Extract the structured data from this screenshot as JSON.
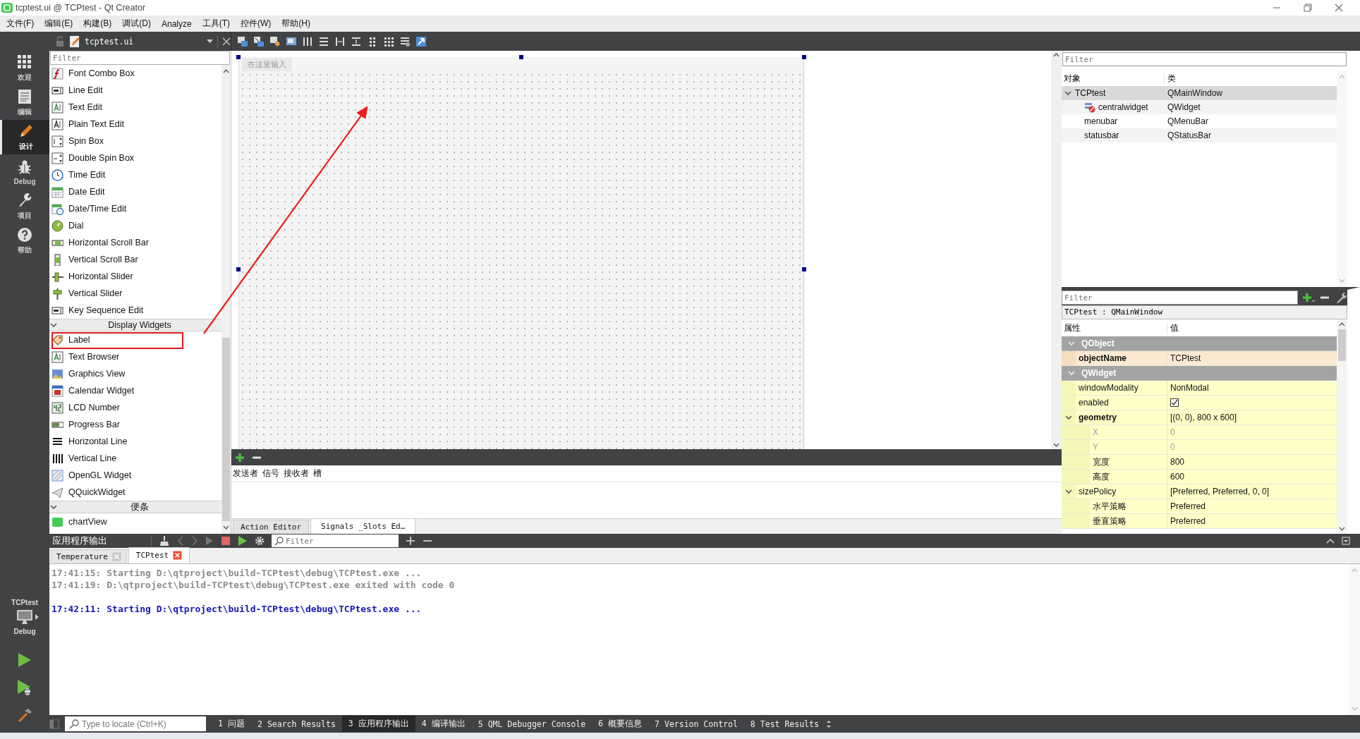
{
  "window": {
    "title": "tcptest.ui @ TCPtest - Qt Creator"
  },
  "menu": [
    "文件(F)",
    "编辑(E)",
    "构建(B)",
    "调试(D)",
    "Analyze",
    "工具(T)",
    "控件(W)",
    "帮助(H)"
  ],
  "mode_bar": {
    "modes": [
      {
        "label": "欢迎",
        "selected": false
      },
      {
        "label": "编辑",
        "selected": false
      },
      {
        "label": "设计",
        "selected": true
      },
      {
        "label": "Debug",
        "selected": false
      },
      {
        "label": "项目",
        "selected": false
      },
      {
        "label": "帮助",
        "selected": false
      }
    ],
    "kit": {
      "project": "TCPtest",
      "build": "Debug"
    }
  },
  "editor_toolbar": {
    "file": "tcptest.ui"
  },
  "widget_box": {
    "filter": {
      "placeholder": "Filter"
    },
    "items": [
      {
        "kind": "widget",
        "label": "Font Combo Box",
        "highlighted": false
      },
      {
        "kind": "widget",
        "label": "Line Edit",
        "highlighted": false
      },
      {
        "kind": "widget",
        "label": "Text Edit",
        "highlighted": false
      },
      {
        "kind": "widget",
        "label": "Plain Text Edit",
        "highlighted": false
      },
      {
        "kind": "widget",
        "label": "Spin Box",
        "highlighted": false
      },
      {
        "kind": "widget",
        "label": "Double Spin Box",
        "highlighted": false
      },
      {
        "kind": "widget",
        "label": "Time Edit",
        "highlighted": false
      },
      {
        "kind": "widget",
        "label": "Date Edit",
        "highlighted": false
      },
      {
        "kind": "widget",
        "label": "Date/Time Edit",
        "highlighted": false
      },
      {
        "kind": "widget",
        "label": "Dial",
        "highlighted": false
      },
      {
        "kind": "widget",
        "label": "Horizontal Scroll Bar",
        "highlighted": false
      },
      {
        "kind": "widget",
        "label": "Vertical Scroll Bar",
        "highlighted": false
      },
      {
        "kind": "widget",
        "label": "Horizontal Slider",
        "highlighted": false
      },
      {
        "kind": "widget",
        "label": "Vertical Slider",
        "highlighted": false
      },
      {
        "kind": "widget",
        "label": "Key Sequence Edit",
        "highlighted": false
      },
      {
        "kind": "category",
        "label": "Display Widgets",
        "expanded": true,
        "highlighted": false
      },
      {
        "kind": "widget",
        "label": "Label",
        "highlighted": true
      },
      {
        "kind": "widget",
        "label": "Text Browser",
        "highlighted": false
      },
      {
        "kind": "widget",
        "label": "Graphics View",
        "highlighted": false
      },
      {
        "kind": "widget",
        "label": "Calendar Widget",
        "highlighted": false
      },
      {
        "kind": "widget",
        "label": "LCD Number",
        "highlighted": false
      },
      {
        "kind": "widget",
        "label": "Progress Bar",
        "highlighted": false
      },
      {
        "kind": "widget",
        "label": "Horizontal Line",
        "highlighted": false
      },
      {
        "kind": "widget",
        "label": "Vertical Line",
        "highlighted": false
      },
      {
        "kind": "widget",
        "label": "OpenGL Widget",
        "highlighted": false
      },
      {
        "kind": "widget",
        "label": "QQuickWidget",
        "highlighted": false
      },
      {
        "kind": "category",
        "label": "便条",
        "expanded": true,
        "highlighted": false
      },
      {
        "kind": "widget",
        "label": "chartView",
        "highlighted": false
      }
    ]
  },
  "form_editor": {
    "form": {
      "selected": true,
      "menu_placeholder": "在这里输入"
    },
    "annotation_arrow": true
  },
  "signal_slot_editor": {
    "columns": [
      "发送者",
      "信号",
      "接收者",
      "槽"
    ],
    "tabs": [
      {
        "label": "Action Editor",
        "selected": false
      },
      {
        "label": "Signals _Slots Ed…",
        "selected": true
      }
    ]
  },
  "object_inspector": {
    "filter": {
      "placeholder": "Filter"
    },
    "columns": [
      "对象",
      "类"
    ],
    "tree": [
      {
        "name": "TCPtest",
        "class": "QMainWindow",
        "selected": true,
        "expanded": true,
        "children": [
          {
            "name": "centralwidget",
            "class": "QWidget",
            "kind": "container",
            "selected": false
          },
          {
            "name": "menubar",
            "class": "QMenuBar",
            "kind": "plain",
            "selected": false
          },
          {
            "name": "statusbar",
            "class": "QStatusBar",
            "kind": "plain",
            "selected": false
          }
        ]
      }
    ]
  },
  "property_editor": {
    "filter": {
      "placeholder": "Filter"
    },
    "context": "TCPtest : QMainWindow",
    "columns": [
      "属性",
      "值"
    ],
    "groups": [
      {
        "name": "QObject",
        "expanded": true,
        "properties": [
          {
            "name": "objectName",
            "kind": "text",
            "value": "TCPtest",
            "modified": true
          }
        ]
      },
      {
        "name": "QWidget",
        "expanded": true,
        "properties": [
          {
            "name": "windowModality",
            "kind": "text",
            "value": "NonModal",
            "modified": false
          },
          {
            "name": "enabled",
            "kind": "checkbox",
            "checked": true,
            "modified": false
          },
          {
            "name": "geometry",
            "kind": "text",
            "value": "[(0, 0), 800 x 600]",
            "modified": true,
            "expanded": true,
            "children": [
              {
                "name": "X",
                "value": "0",
                "disabled": true
              },
              {
                "name": "Y",
                "value": "0",
                "disabled": true
              },
              {
                "name": "宽度",
                "value": "800",
                "disabled": false
              },
              {
                "name": "高度",
                "value": "600",
                "disabled": false
              }
            ]
          },
          {
            "name": "sizePolicy",
            "kind": "text",
            "value": "[Preferred, Preferred, 0, 0]",
            "modified": false,
            "expanded": true,
            "children": [
              {
                "name": "水平策略",
                "value": "Preferred",
                "disabled": false
              },
              {
                "name": "垂直策略",
                "value": "Preferred",
                "disabled": false
              }
            ]
          }
        ]
      }
    ]
  },
  "output_pane": {
    "title": "应用程序输出",
    "filter": {
      "placeholder": "Filter"
    },
    "tabs": [
      {
        "label": "Temperature",
        "selected": false
      },
      {
        "label": "TCPtest",
        "selected": true
      }
    ],
    "lines": [
      {
        "kind": "finished",
        "text": "17:41:15: Starting D:\\qtproject\\build-TCPtest\\debug\\TCPtest.exe ..."
      },
      {
        "kind": "finished",
        "text": "17:41:19: D:\\qtproject\\build-TCPtest\\debug\\TCPtest.exe exited with code 0"
      },
      {
        "kind": "running",
        "text": "17:42:11: Starting D:\\qtproject\\build-TCPtest\\debug\\TCPtest.exe ..."
      }
    ]
  },
  "status_bar": {
    "locator": {
      "placeholder": "Type to locate (Ctrl+K)"
    },
    "panes": [
      {
        "number": "1",
        "label": "问题",
        "selected": false
      },
      {
        "number": "2",
        "label": "Search Results",
        "selected": false
      },
      {
        "number": "3",
        "label": "应用程序输出",
        "selected": true
      },
      {
        "number": "4",
        "label": "编译输出",
        "selected": false
      },
      {
        "number": "5",
        "label": "QML Debugger Console",
        "selected": false
      },
      {
        "number": "6",
        "label": "概要信息",
        "selected": false
      },
      {
        "number": "7",
        "label": "Version Control",
        "selected": false
      },
      {
        "number": "8",
        "label": "Test Results",
        "selected": false
      }
    ]
  }
}
